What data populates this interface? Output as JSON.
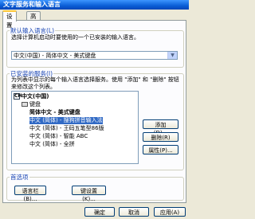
{
  "window": {
    "title": "文字服务和输入语言"
  },
  "tabs": [
    {
      "label": "设置"
    },
    {
      "label": "高级"
    }
  ],
  "default_lang": {
    "title": "默认输入语言(L)",
    "desc": "选择计算机启动时要使用的一个已安装的输入语言。",
    "selected": "中文(中国) - 简体中文 - 美式键盘"
  },
  "installed": {
    "title": "已安装的服务(I)",
    "desc": "为列表中显示的每个输入语言选择服务。使用 \"添加\" 和 \"删除\" 按钮来修改这个列表。",
    "tree": {
      "root": "中文(中国)",
      "keyboard": "键盘",
      "items": [
        "简体中文 - 美式键盘",
        "中文 (简体) - 搜狗拼音输入法",
        "中文 (简体) - 王码五笔型86版",
        "中文 (简体) - 智能 ABC",
        "中文 (简体) - 全拼"
      ]
    },
    "buttons": {
      "add": "添加(D)...",
      "remove": "删除(R)",
      "properties": "属性(P)..."
    }
  },
  "prefs": {
    "title": "首选项",
    "language_bar": "语言栏(B)...",
    "key_settings": "键设置(K)..."
  },
  "footer": {
    "ok": "确定",
    "cancel": "取消",
    "apply": "应用(A)"
  },
  "colors": {
    "selection": "#316ac5",
    "title_bar": "#0a5ed6"
  }
}
